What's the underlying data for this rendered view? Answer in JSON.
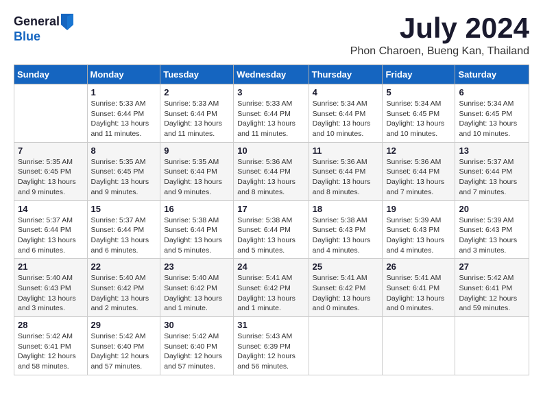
{
  "logo": {
    "general": "General",
    "blue": "Blue"
  },
  "title": {
    "month_year": "July 2024",
    "location": "Phon Charoen, Bueng Kan, Thailand"
  },
  "headers": [
    "Sunday",
    "Monday",
    "Tuesday",
    "Wednesday",
    "Thursday",
    "Friday",
    "Saturday"
  ],
  "weeks": [
    [
      {
        "day": "",
        "info": ""
      },
      {
        "day": "1",
        "info": "Sunrise: 5:33 AM\nSunset: 6:44 PM\nDaylight: 13 hours\nand 11 minutes."
      },
      {
        "day": "2",
        "info": "Sunrise: 5:33 AM\nSunset: 6:44 PM\nDaylight: 13 hours\nand 11 minutes."
      },
      {
        "day": "3",
        "info": "Sunrise: 5:33 AM\nSunset: 6:44 PM\nDaylight: 13 hours\nand 11 minutes."
      },
      {
        "day": "4",
        "info": "Sunrise: 5:34 AM\nSunset: 6:44 PM\nDaylight: 13 hours\nand 10 minutes."
      },
      {
        "day": "5",
        "info": "Sunrise: 5:34 AM\nSunset: 6:45 PM\nDaylight: 13 hours\nand 10 minutes."
      },
      {
        "day": "6",
        "info": "Sunrise: 5:34 AM\nSunset: 6:45 PM\nDaylight: 13 hours\nand 10 minutes."
      }
    ],
    [
      {
        "day": "7",
        "info": "Sunrise: 5:35 AM\nSunset: 6:45 PM\nDaylight: 13 hours\nand 9 minutes."
      },
      {
        "day": "8",
        "info": "Sunrise: 5:35 AM\nSunset: 6:45 PM\nDaylight: 13 hours\nand 9 minutes."
      },
      {
        "day": "9",
        "info": "Sunrise: 5:35 AM\nSunset: 6:44 PM\nDaylight: 13 hours\nand 9 minutes."
      },
      {
        "day": "10",
        "info": "Sunrise: 5:36 AM\nSunset: 6:44 PM\nDaylight: 13 hours\nand 8 minutes."
      },
      {
        "day": "11",
        "info": "Sunrise: 5:36 AM\nSunset: 6:44 PM\nDaylight: 13 hours\nand 8 minutes."
      },
      {
        "day": "12",
        "info": "Sunrise: 5:36 AM\nSunset: 6:44 PM\nDaylight: 13 hours\nand 7 minutes."
      },
      {
        "day": "13",
        "info": "Sunrise: 5:37 AM\nSunset: 6:44 PM\nDaylight: 13 hours\nand 7 minutes."
      }
    ],
    [
      {
        "day": "14",
        "info": "Sunrise: 5:37 AM\nSunset: 6:44 PM\nDaylight: 13 hours\nand 6 minutes."
      },
      {
        "day": "15",
        "info": "Sunrise: 5:37 AM\nSunset: 6:44 PM\nDaylight: 13 hours\nand 6 minutes."
      },
      {
        "day": "16",
        "info": "Sunrise: 5:38 AM\nSunset: 6:44 PM\nDaylight: 13 hours\nand 5 minutes."
      },
      {
        "day": "17",
        "info": "Sunrise: 5:38 AM\nSunset: 6:44 PM\nDaylight: 13 hours\nand 5 minutes."
      },
      {
        "day": "18",
        "info": "Sunrise: 5:38 AM\nSunset: 6:43 PM\nDaylight: 13 hours\nand 4 minutes."
      },
      {
        "day": "19",
        "info": "Sunrise: 5:39 AM\nSunset: 6:43 PM\nDaylight: 13 hours\nand 4 minutes."
      },
      {
        "day": "20",
        "info": "Sunrise: 5:39 AM\nSunset: 6:43 PM\nDaylight: 13 hours\nand 3 minutes."
      }
    ],
    [
      {
        "day": "21",
        "info": "Sunrise: 5:40 AM\nSunset: 6:43 PM\nDaylight: 13 hours\nand 3 minutes."
      },
      {
        "day": "22",
        "info": "Sunrise: 5:40 AM\nSunset: 6:42 PM\nDaylight: 13 hours\nand 2 minutes."
      },
      {
        "day": "23",
        "info": "Sunrise: 5:40 AM\nSunset: 6:42 PM\nDaylight: 13 hours\nand 1 minute."
      },
      {
        "day": "24",
        "info": "Sunrise: 5:41 AM\nSunset: 6:42 PM\nDaylight: 13 hours\nand 1 minute."
      },
      {
        "day": "25",
        "info": "Sunrise: 5:41 AM\nSunset: 6:42 PM\nDaylight: 13 hours\nand 0 minutes."
      },
      {
        "day": "26",
        "info": "Sunrise: 5:41 AM\nSunset: 6:41 PM\nDaylight: 13 hours\nand 0 minutes."
      },
      {
        "day": "27",
        "info": "Sunrise: 5:42 AM\nSunset: 6:41 PM\nDaylight: 12 hours\nand 59 minutes."
      }
    ],
    [
      {
        "day": "28",
        "info": "Sunrise: 5:42 AM\nSunset: 6:41 PM\nDaylight: 12 hours\nand 58 minutes."
      },
      {
        "day": "29",
        "info": "Sunrise: 5:42 AM\nSunset: 6:40 PM\nDaylight: 12 hours\nand 57 minutes."
      },
      {
        "day": "30",
        "info": "Sunrise: 5:42 AM\nSunset: 6:40 PM\nDaylight: 12 hours\nand 57 minutes."
      },
      {
        "day": "31",
        "info": "Sunrise: 5:43 AM\nSunset: 6:39 PM\nDaylight: 12 hours\nand 56 minutes."
      },
      {
        "day": "",
        "info": ""
      },
      {
        "day": "",
        "info": ""
      },
      {
        "day": "",
        "info": ""
      }
    ]
  ]
}
